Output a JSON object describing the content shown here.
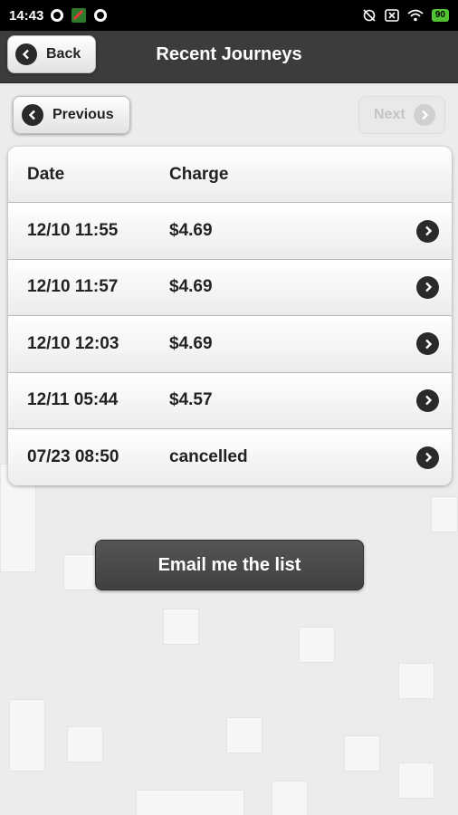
{
  "status": {
    "time": "14:43",
    "battery": "90"
  },
  "header": {
    "title": "Recent Journeys",
    "back_label": "Back"
  },
  "pager": {
    "previous_label": "Previous",
    "next_label": "Next"
  },
  "table": {
    "headers": {
      "date": "Date",
      "charge": "Charge"
    },
    "rows": [
      {
        "date": "12/10 11:55",
        "charge": "$4.69"
      },
      {
        "date": "12/10 11:57",
        "charge": "$4.69"
      },
      {
        "date": "12/10 12:03",
        "charge": "$4.69"
      },
      {
        "date": "12/11 05:44",
        "charge": "$4.57"
      },
      {
        "date": "07/23 08:50",
        "charge": "cancelled"
      }
    ]
  },
  "actions": {
    "email_label": "Email me the list"
  }
}
